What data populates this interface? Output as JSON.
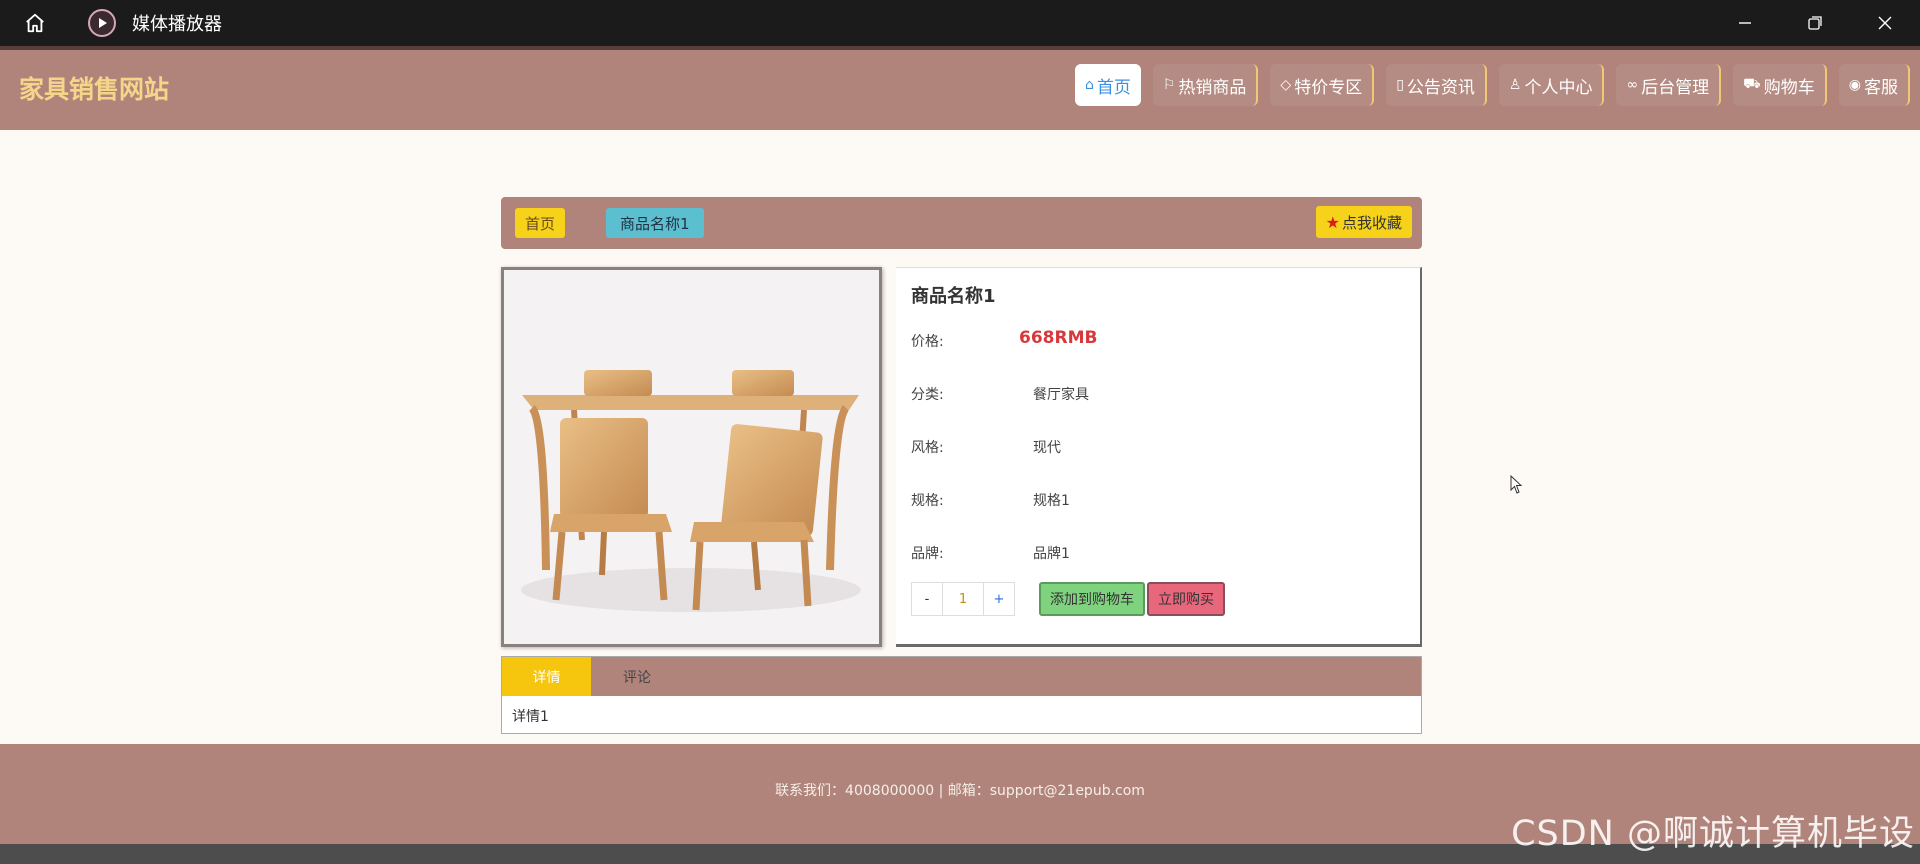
{
  "window": {
    "title": "媒体播放器"
  },
  "site": {
    "brand": "家具销售网站"
  },
  "nav": {
    "items": [
      {
        "label": "首页",
        "icon": "home-icon",
        "active": true
      },
      {
        "label": "热销商品",
        "icon": "flag-icon",
        "active": false
      },
      {
        "label": "特价专区",
        "icon": "tag-icon",
        "active": false
      },
      {
        "label": "公告资讯",
        "icon": "document-icon",
        "active": false
      },
      {
        "label": "个人中心",
        "icon": "user-icon",
        "active": false
      },
      {
        "label": "后台管理",
        "icon": "link-icon",
        "active": false
      },
      {
        "label": "购物车",
        "icon": "cart-icon",
        "active": false
      },
      {
        "label": "客服",
        "icon": "chat-icon",
        "active": false
      }
    ]
  },
  "breadcrumb": {
    "home": "首页",
    "current": "商品名称1"
  },
  "favorite_label": "点我收藏",
  "product": {
    "name": "商品名称1",
    "price_label": "价格:",
    "price": "668RMB",
    "category_label": "分类:",
    "category": "餐厅家具",
    "style_label": "风格:",
    "style": "现代",
    "spec_label": "规格:",
    "spec": "规格1",
    "brand_label": "品牌:",
    "brand": "品牌1",
    "quantity": "1",
    "minus": "-",
    "plus": "+",
    "add_to_cart": "添加到购物车",
    "buy_now": "立即购买"
  },
  "tabs": {
    "details": "详情",
    "comments": "评论",
    "details_content": "详情1"
  },
  "footer": {
    "contact": "联系我们：4008000000 | 邮箱：support@21epub.com"
  },
  "watermark": "CSDN @啊诚计算机毕设",
  "colors": {
    "nav_bg": "#b0847b",
    "brand": "#f4d58a",
    "accent_yellow": "#f6d21a",
    "price_red": "#d9383a"
  }
}
